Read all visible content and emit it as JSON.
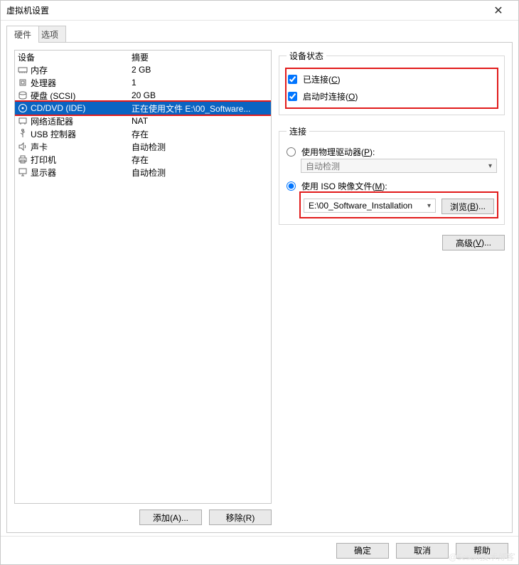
{
  "window": {
    "title": "虚拟机设置"
  },
  "tabs": {
    "hardware": "硬件",
    "options": "选项"
  },
  "headers": {
    "device": "设备",
    "summary": "摘要"
  },
  "devices": [
    {
      "icon": "memory",
      "name": "内存",
      "summary": "2 GB"
    },
    {
      "icon": "cpu",
      "name": "处理器",
      "summary": "1"
    },
    {
      "icon": "disk",
      "name": "硬盘 (SCSI)",
      "summary": "20 GB"
    },
    {
      "icon": "cd",
      "name": "CD/DVD (IDE)",
      "summary": "正在使用文件 E:\\00_Software...",
      "selected": true
    },
    {
      "icon": "net",
      "name": "网络适配器",
      "summary": "NAT"
    },
    {
      "icon": "usb",
      "name": "USB 控制器",
      "summary": "存在"
    },
    {
      "icon": "sound",
      "name": "声卡",
      "summary": "自动检测"
    },
    {
      "icon": "printer",
      "name": "打印机",
      "summary": "存在"
    },
    {
      "icon": "display",
      "name": "显示器",
      "summary": "自动检测"
    }
  ],
  "leftButtons": {
    "add": "添加(A)...",
    "remove": "移除(R)"
  },
  "status": {
    "legend": "设备状态",
    "connected": "已连接(C)",
    "connectAtPowerOn": "启动时连接(O)"
  },
  "connection": {
    "legend": "连接",
    "usePhysical": "使用物理驱动器(P):",
    "physicalValue": "自动检测",
    "useIso": "使用 ISO 映像文件(M):",
    "isoPath": "E:\\00_Software_Installation",
    "browse": "浏览(B)..."
  },
  "advanced": "高级(V)...",
  "footer": {
    "ok": "确定",
    "cancel": "取消",
    "help": "帮助"
  },
  "watermark": "@5csdn技术博客"
}
